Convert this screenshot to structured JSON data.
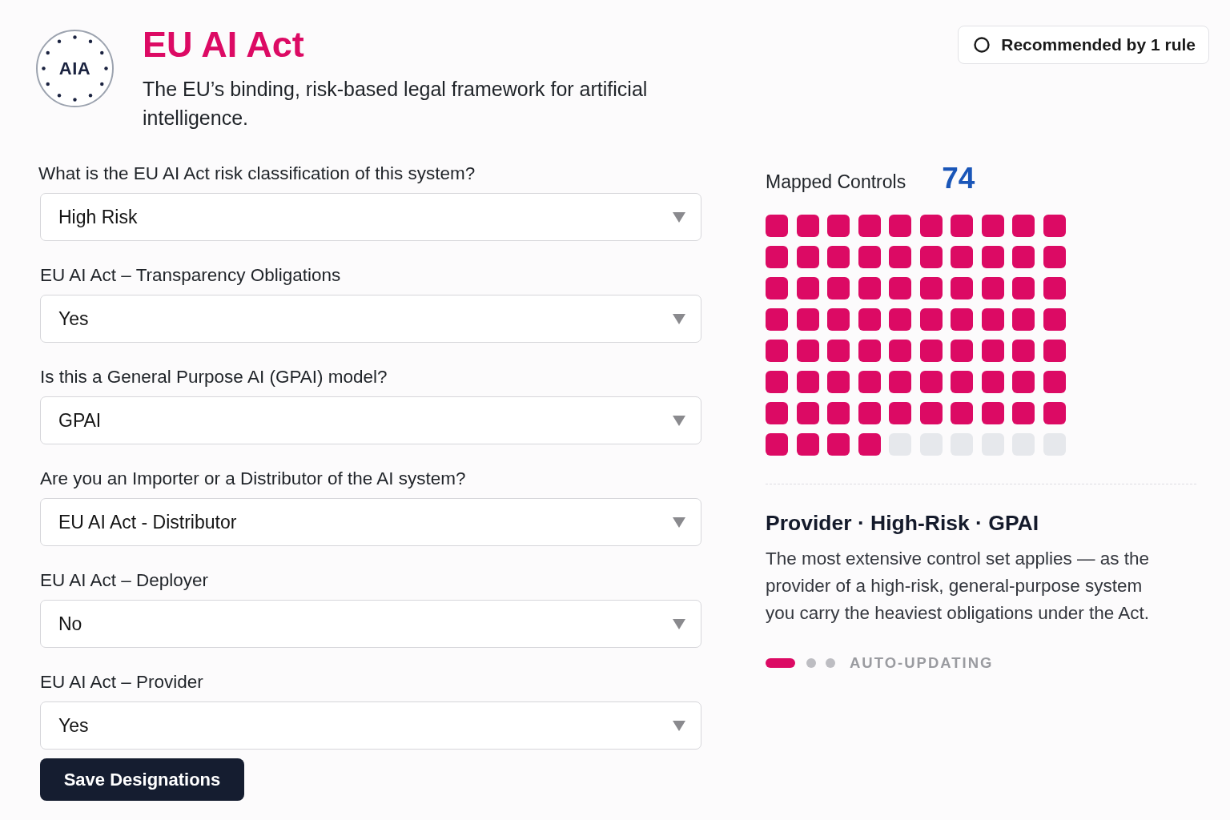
{
  "header": {
    "logo": {
      "text": "AIA"
    },
    "title": "EU AI Act",
    "description": "The EU’s binding, risk-based legal framework for artificial intelligence.",
    "recommendation_badge": {
      "label": "Recommended by 1 rule"
    }
  },
  "questions": [
    {
      "label": "What is the EU AI Act risk classification of this system?",
      "value": "High Risk"
    },
    {
      "label": "EU AI Act – Transparency Obligations",
      "value": "Yes"
    },
    {
      "label": "Is this a General Purpose AI (GPAI) model?",
      "value": "GPAI"
    },
    {
      "label": "Are you an Importer or a Distributor of the AI system?",
      "value": "EU AI Act - Distributor"
    },
    {
      "label": "EU AI Act – Deployer",
      "value": "No"
    },
    {
      "label": "EU AI Act – Provider",
      "value": "Yes"
    }
  ],
  "save_button": {
    "label": "Save Designations"
  },
  "mapped_controls": {
    "label": "Mapped Controls",
    "count": "74",
    "cells": [
      {
        "filled": true
      },
      {
        "filled": true
      },
      {
        "filled": true
      },
      {
        "filled": true
      },
      {
        "filled": true
      },
      {
        "filled": true
      },
      {
        "filled": true
      },
      {
        "filled": true
      },
      {
        "filled": true
      },
      {
        "filled": true
      },
      {
        "filled": true
      },
      {
        "filled": true
      },
      {
        "filled": true
      },
      {
        "filled": true
      },
      {
        "filled": true
      },
      {
        "filled": true
      },
      {
        "filled": true
      },
      {
        "filled": true
      },
      {
        "filled": true
      },
      {
        "filled": true
      },
      {
        "filled": true
      },
      {
        "filled": true
      },
      {
        "filled": true
      },
      {
        "filled": true
      },
      {
        "filled": true
      },
      {
        "filled": true
      },
      {
        "filled": true
      },
      {
        "filled": true
      },
      {
        "filled": true
      },
      {
        "filled": true
      },
      {
        "filled": true
      },
      {
        "filled": true
      },
      {
        "filled": true
      },
      {
        "filled": true
      },
      {
        "filled": true
      },
      {
        "filled": true
      },
      {
        "filled": true
      },
      {
        "filled": true
      },
      {
        "filled": true
      },
      {
        "filled": true
      },
      {
        "filled": true
      },
      {
        "filled": true
      },
      {
        "filled": true
      },
      {
        "filled": true
      },
      {
        "filled": true
      },
      {
        "filled": true
      },
      {
        "filled": true
      },
      {
        "filled": true
      },
      {
        "filled": true
      },
      {
        "filled": true
      },
      {
        "filled": true
      },
      {
        "filled": true
      },
      {
        "filled": true
      },
      {
        "filled": true
      },
      {
        "filled": true
      },
      {
        "filled": true
      },
      {
        "filled": true
      },
      {
        "filled": true
      },
      {
        "filled": true
      },
      {
        "filled": true
      },
      {
        "filled": true
      },
      {
        "filled": true
      },
      {
        "filled": true
      },
      {
        "filled": true
      },
      {
        "filled": true
      },
      {
        "filled": true
      },
      {
        "filled": true
      },
      {
        "filled": true
      },
      {
        "filled": true
      },
      {
        "filled": true
      },
      {
        "filled": true
      },
      {
        "filled": true
      },
      {
        "filled": true
      },
      {
        "filled": true
      },
      {
        "filled": false
      },
      {
        "filled": false
      },
      {
        "filled": false
      },
      {
        "filled": false
      },
      {
        "filled": false
      },
      {
        "filled": false
      }
    ]
  },
  "profile": {
    "title": "Provider · High-Risk · GPAI",
    "description": "The most extensive control set applies — as the provider of a high-risk, general-purpose system you carry the heaviest obligations under the Act.",
    "progress_steps": [
      {
        "selected": true
      },
      {
        "selected": false
      },
      {
        "selected": false
      }
    ],
    "status": "AUTO-UPDATING"
  }
}
